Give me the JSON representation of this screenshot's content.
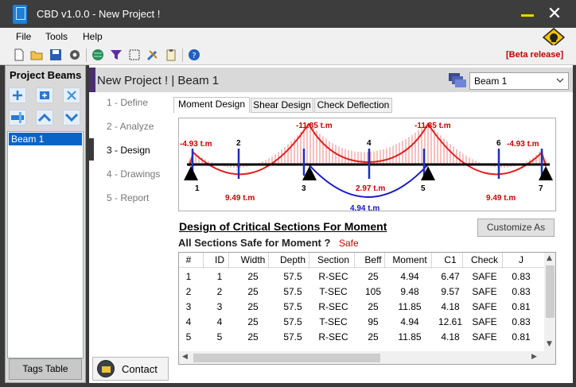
{
  "window": {
    "title": "CBD v1.0.0 - New Project !"
  },
  "menu": {
    "items": [
      "File",
      "Tools",
      "Help"
    ]
  },
  "toolbar": {
    "icons": [
      "new-file-icon",
      "open-folder-icon",
      "save-icon",
      "settings-icon",
      "globe-icon",
      "funnel-icon",
      "select-area-icon",
      "tools-icon",
      "clipboard-icon",
      "help-icon"
    ],
    "beta_label": "[Beta release]"
  },
  "left_panel": {
    "title": "Project Beams",
    "beams": [
      "Beam 1"
    ],
    "tags_button": "Tags Table"
  },
  "header": {
    "title": "New Project ! | Beam 1",
    "selected_beam": "Beam 1"
  },
  "nav": {
    "steps": [
      "1 - Define",
      "2 - Analyze",
      "3 - Design",
      "4 - Drawings",
      "5 - Report"
    ],
    "active_index": 2,
    "contact_label": "Contact"
  },
  "tabs": [
    "Moment Design",
    "Shear Design",
    "Check Deflection"
  ],
  "diagram": {
    "moment_labels": [
      "-4.93 t.m",
      "-11.85 t.m",
      "-11.85 t.m",
      "-4.93 t.m",
      "9.49 t.m",
      "2.97 t.m",
      "4.94 t.m",
      "9.49 t.m"
    ],
    "section_ids": [
      "1",
      "2",
      "3",
      "4",
      "5",
      "6",
      "7"
    ],
    "colors": {
      "negative": "#e02020",
      "positive": "#1818c8",
      "hatch": "#f08080"
    }
  },
  "results": {
    "title": "Design of Critical Sections For Moment",
    "safe_question": "All Sections Safe for Moment ?",
    "safe_value": "Safe",
    "customize_button": "Customize As"
  },
  "table": {
    "columns": [
      "#",
      "ID",
      "Width",
      "Depth",
      "Section",
      "Beff",
      "Moment",
      "C1",
      "Check",
      "J"
    ],
    "rows": [
      [
        "1",
        "1",
        "25",
        "57.5",
        "R-SEC",
        "25",
        "4.94",
        "6.47",
        "SAFE",
        "0.83"
      ],
      [
        "2",
        "2",
        "25",
        "57.5",
        "T-SEC",
        "105",
        "9.48",
        "9.57",
        "SAFE",
        "0.83"
      ],
      [
        "3",
        "3",
        "25",
        "57.5",
        "R-SEC",
        "25",
        "11.85",
        "4.18",
        "SAFE",
        "0.81"
      ],
      [
        "4",
        "4",
        "25",
        "57.5",
        "T-SEC",
        "95",
        "4.94",
        "12.61",
        "SAFE",
        "0.83"
      ],
      [
        "5",
        "5",
        "25",
        "57.5",
        "R-SEC",
        "25",
        "11.85",
        "4.18",
        "SAFE",
        "0.81"
      ]
    ]
  }
}
